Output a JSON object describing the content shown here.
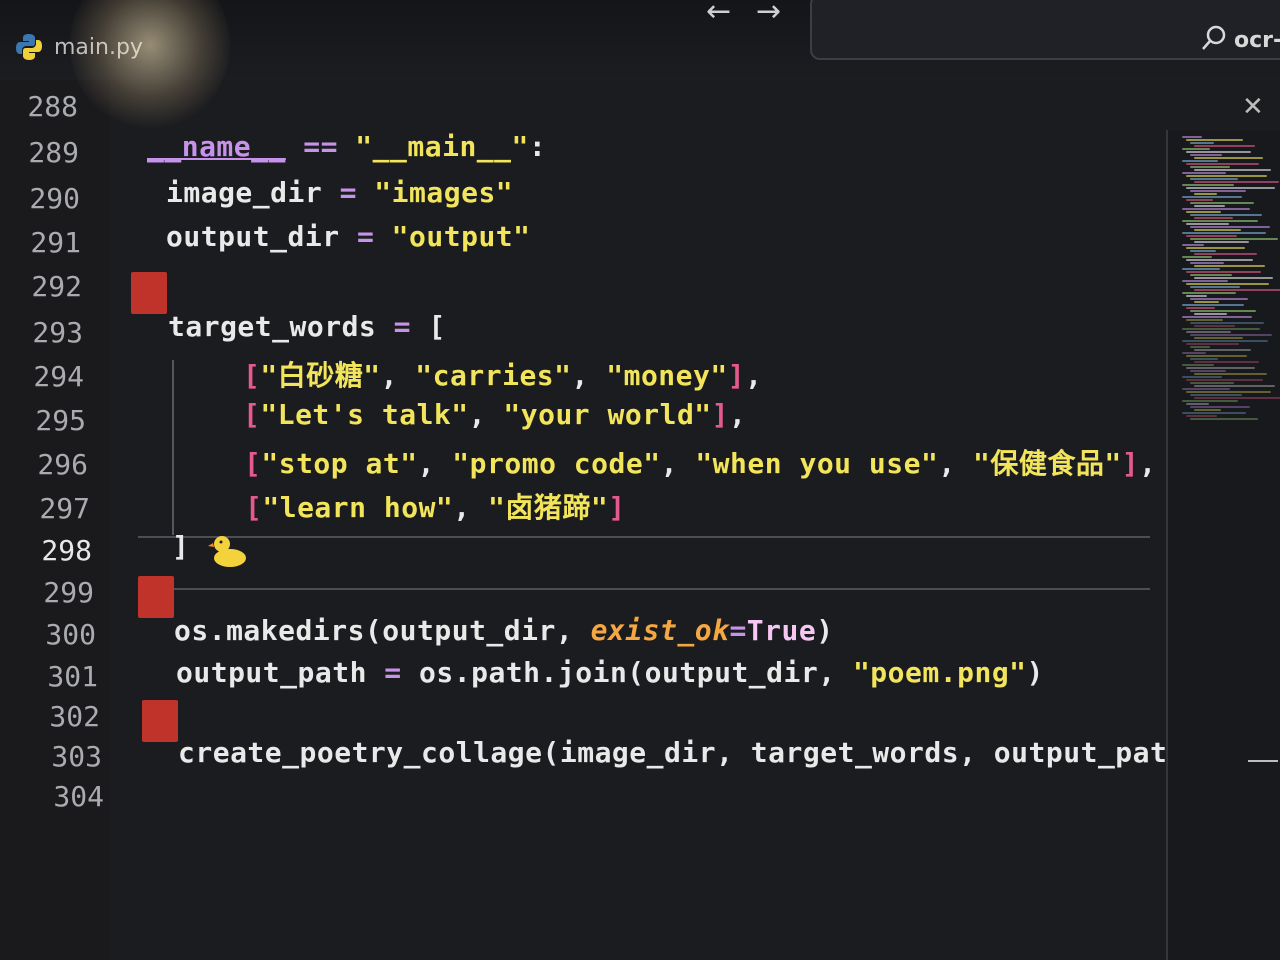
{
  "tab": {
    "filename": "main.py",
    "icon": "python-icon"
  },
  "search": {
    "text": "ocr-v"
  },
  "icons": {
    "back": "arrow-left-icon",
    "forward": "arrow-right-icon",
    "search": "search-icon",
    "close": "close-icon"
  },
  "colors": {
    "keyword": "#c792ea",
    "string": "#f3e55b",
    "bracket": "#e45a8e",
    "parameter": "#f5a742",
    "breakpoint": "#c0332b",
    "background": "#1b1c1f"
  },
  "current_line": "298",
  "lines": [
    {
      "num": "288",
      "tokens": []
    },
    {
      "num": "289",
      "tokens": [
        [
          "kw",
          "__name__"
        ],
        [
          "var",
          " "
        ],
        [
          "op",
          "=="
        ],
        [
          "var",
          " "
        ],
        [
          "str",
          "\"__main__\""
        ],
        [
          "var",
          ":"
        ]
      ]
    },
    {
      "num": "290",
      "tokens": [
        [
          "var",
          "image_dir "
        ],
        [
          "op",
          "="
        ],
        [
          "var",
          " "
        ],
        [
          "str",
          "\"images\""
        ]
      ]
    },
    {
      "num": "291",
      "tokens": [
        [
          "var",
          "output_dir "
        ],
        [
          "op",
          "="
        ],
        [
          "var",
          " "
        ],
        [
          "str",
          "\"output\""
        ]
      ]
    },
    {
      "num": "292",
      "tokens": []
    },
    {
      "num": "293",
      "tokens": [
        [
          "var",
          "target_words "
        ],
        [
          "op",
          "="
        ],
        [
          "var",
          " ["
        ]
      ]
    },
    {
      "num": "294",
      "tokens": [
        [
          "br",
          "["
        ],
        [
          "str",
          "\"白砂糖\""
        ],
        [
          "var",
          ", "
        ],
        [
          "str",
          "\"carries\""
        ],
        [
          "var",
          ", "
        ],
        [
          "str",
          "\"money\""
        ],
        [
          "br",
          "]"
        ],
        [
          "var",
          ","
        ]
      ]
    },
    {
      "num": "295",
      "tokens": [
        [
          "br",
          "["
        ],
        [
          "str",
          "\"Let's talk\""
        ],
        [
          "var",
          ", "
        ],
        [
          "str",
          "\"your world\""
        ],
        [
          "br",
          "]"
        ],
        [
          "var",
          ","
        ]
      ]
    },
    {
      "num": "296",
      "tokens": [
        [
          "br",
          "["
        ],
        [
          "str",
          "\"stop at\""
        ],
        [
          "var",
          ", "
        ],
        [
          "str",
          "\"promo code\""
        ],
        [
          "var",
          ", "
        ],
        [
          "str",
          "\"when you use\""
        ],
        [
          "var",
          ", "
        ],
        [
          "str",
          "\"保健食品\""
        ],
        [
          "br",
          "]"
        ],
        [
          "var",
          ","
        ]
      ]
    },
    {
      "num": "297",
      "tokens": [
        [
          "br",
          "["
        ],
        [
          "str",
          "\"learn how\""
        ],
        [
          "var",
          ", "
        ],
        [
          "str",
          "\"卤猪蹄\""
        ],
        [
          "br",
          "]"
        ]
      ]
    },
    {
      "num": "298",
      "tokens": [
        [
          "var",
          "]"
        ]
      ]
    },
    {
      "num": "299",
      "tokens": []
    },
    {
      "num": "300",
      "tokens": [
        [
          "fn",
          "os.makedirs(output_dir, "
        ],
        [
          "param",
          "exist_ok"
        ],
        [
          "op",
          "="
        ],
        [
          "const",
          "True"
        ],
        [
          "fn",
          ")"
        ]
      ]
    },
    {
      "num": "301",
      "tokens": [
        [
          "var",
          "output_path "
        ],
        [
          "op",
          "="
        ],
        [
          "var",
          " os.path.join(output_dir, "
        ],
        [
          "str",
          "\"poem.png\""
        ],
        [
          "var",
          ")"
        ]
      ]
    },
    {
      "num": "302",
      "tokens": []
    },
    {
      "num": "303",
      "tokens": [
        [
          "fn",
          "create_poetry_collage(image_dir, target_words, output_path)"
        ]
      ]
    },
    {
      "num": "304",
      "tokens": []
    }
  ]
}
